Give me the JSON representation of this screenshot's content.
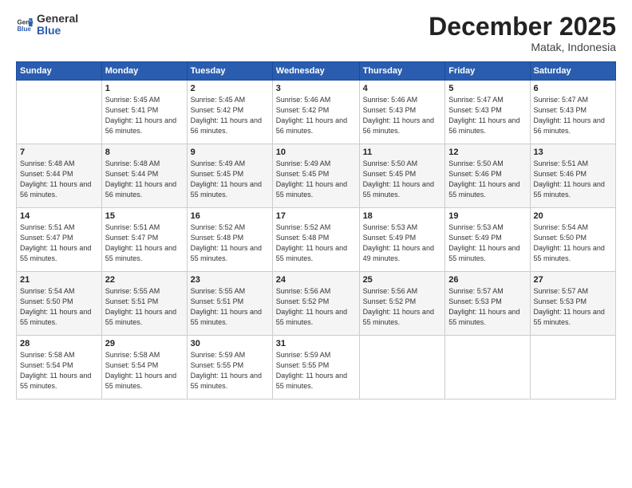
{
  "header": {
    "logo_general": "General",
    "logo_blue": "Blue",
    "month_title": "December 2025",
    "location": "Matak, Indonesia"
  },
  "days_of_week": [
    "Sunday",
    "Monday",
    "Tuesday",
    "Wednesday",
    "Thursday",
    "Friday",
    "Saturday"
  ],
  "weeks": [
    [
      {
        "day": "",
        "sunrise": "",
        "sunset": "",
        "daylight": ""
      },
      {
        "day": "1",
        "sunrise": "Sunrise: 5:45 AM",
        "sunset": "Sunset: 5:41 PM",
        "daylight": "Daylight: 11 hours and 56 minutes."
      },
      {
        "day": "2",
        "sunrise": "Sunrise: 5:45 AM",
        "sunset": "Sunset: 5:42 PM",
        "daylight": "Daylight: 11 hours and 56 minutes."
      },
      {
        "day": "3",
        "sunrise": "Sunrise: 5:46 AM",
        "sunset": "Sunset: 5:42 PM",
        "daylight": "Daylight: 11 hours and 56 minutes."
      },
      {
        "day": "4",
        "sunrise": "Sunrise: 5:46 AM",
        "sunset": "Sunset: 5:43 PM",
        "daylight": "Daylight: 11 hours and 56 minutes."
      },
      {
        "day": "5",
        "sunrise": "Sunrise: 5:47 AM",
        "sunset": "Sunset: 5:43 PM",
        "daylight": "Daylight: 11 hours and 56 minutes."
      },
      {
        "day": "6",
        "sunrise": "Sunrise: 5:47 AM",
        "sunset": "Sunset: 5:43 PM",
        "daylight": "Daylight: 11 hours and 56 minutes."
      }
    ],
    [
      {
        "day": "7",
        "sunrise": "Sunrise: 5:48 AM",
        "sunset": "Sunset: 5:44 PM",
        "daylight": "Daylight: 11 hours and 56 minutes."
      },
      {
        "day": "8",
        "sunrise": "Sunrise: 5:48 AM",
        "sunset": "Sunset: 5:44 PM",
        "daylight": "Daylight: 11 hours and 56 minutes."
      },
      {
        "day": "9",
        "sunrise": "Sunrise: 5:49 AM",
        "sunset": "Sunset: 5:45 PM",
        "daylight": "Daylight: 11 hours and 55 minutes."
      },
      {
        "day": "10",
        "sunrise": "Sunrise: 5:49 AM",
        "sunset": "Sunset: 5:45 PM",
        "daylight": "Daylight: 11 hours and 55 minutes."
      },
      {
        "day": "11",
        "sunrise": "Sunrise: 5:50 AM",
        "sunset": "Sunset: 5:45 PM",
        "daylight": "Daylight: 11 hours and 55 minutes."
      },
      {
        "day": "12",
        "sunrise": "Sunrise: 5:50 AM",
        "sunset": "Sunset: 5:46 PM",
        "daylight": "Daylight: 11 hours and 55 minutes."
      },
      {
        "day": "13",
        "sunrise": "Sunrise: 5:51 AM",
        "sunset": "Sunset: 5:46 PM",
        "daylight": "Daylight: 11 hours and 55 minutes."
      }
    ],
    [
      {
        "day": "14",
        "sunrise": "Sunrise: 5:51 AM",
        "sunset": "Sunset: 5:47 PM",
        "daylight": "Daylight: 11 hours and 55 minutes."
      },
      {
        "day": "15",
        "sunrise": "Sunrise: 5:51 AM",
        "sunset": "Sunset: 5:47 PM",
        "daylight": "Daylight: 11 hours and 55 minutes."
      },
      {
        "day": "16",
        "sunrise": "Sunrise: 5:52 AM",
        "sunset": "Sunset: 5:48 PM",
        "daylight": "Daylight: 11 hours and 55 minutes."
      },
      {
        "day": "17",
        "sunrise": "Sunrise: 5:52 AM",
        "sunset": "Sunset: 5:48 PM",
        "daylight": "Daylight: 11 hours and 55 minutes."
      },
      {
        "day": "18",
        "sunrise": "Sunrise: 5:53 AM",
        "sunset": "Sunset: 5:49 PM",
        "daylight": "Daylight: 11 hours and 49 minutes."
      },
      {
        "day": "19",
        "sunrise": "Sunrise: 5:53 AM",
        "sunset": "Sunset: 5:49 PM",
        "daylight": "Daylight: 11 hours and 55 minutes."
      },
      {
        "day": "20",
        "sunrise": "Sunrise: 5:54 AM",
        "sunset": "Sunset: 5:50 PM",
        "daylight": "Daylight: 11 hours and 55 minutes."
      }
    ],
    [
      {
        "day": "21",
        "sunrise": "Sunrise: 5:54 AM",
        "sunset": "Sunset: 5:50 PM",
        "daylight": "Daylight: 11 hours and 55 minutes."
      },
      {
        "day": "22",
        "sunrise": "Sunrise: 5:55 AM",
        "sunset": "Sunset: 5:51 PM",
        "daylight": "Daylight: 11 hours and 55 minutes."
      },
      {
        "day": "23",
        "sunrise": "Sunrise: 5:55 AM",
        "sunset": "Sunset: 5:51 PM",
        "daylight": "Daylight: 11 hours and 55 minutes."
      },
      {
        "day": "24",
        "sunrise": "Sunrise: 5:56 AM",
        "sunset": "Sunset: 5:52 PM",
        "daylight": "Daylight: 11 hours and 55 minutes."
      },
      {
        "day": "25",
        "sunrise": "Sunrise: 5:56 AM",
        "sunset": "Sunset: 5:52 PM",
        "daylight": "Daylight: 11 hours and 55 minutes."
      },
      {
        "day": "26",
        "sunrise": "Sunrise: 5:57 AM",
        "sunset": "Sunset: 5:53 PM",
        "daylight": "Daylight: 11 hours and 55 minutes."
      },
      {
        "day": "27",
        "sunrise": "Sunrise: 5:57 AM",
        "sunset": "Sunset: 5:53 PM",
        "daylight": "Daylight: 11 hours and 55 minutes."
      }
    ],
    [
      {
        "day": "28",
        "sunrise": "Sunrise: 5:58 AM",
        "sunset": "Sunset: 5:54 PM",
        "daylight": "Daylight: 11 hours and 55 minutes."
      },
      {
        "day": "29",
        "sunrise": "Sunrise: 5:58 AM",
        "sunset": "Sunset: 5:54 PM",
        "daylight": "Daylight: 11 hours and 55 minutes."
      },
      {
        "day": "30",
        "sunrise": "Sunrise: 5:59 AM",
        "sunset": "Sunset: 5:55 PM",
        "daylight": "Daylight: 11 hours and 55 minutes."
      },
      {
        "day": "31",
        "sunrise": "Sunrise: 5:59 AM",
        "sunset": "Sunset: 5:55 PM",
        "daylight": "Daylight: 11 hours and 55 minutes."
      },
      {
        "day": "",
        "sunrise": "",
        "sunset": "",
        "daylight": ""
      },
      {
        "day": "",
        "sunrise": "",
        "sunset": "",
        "daylight": ""
      },
      {
        "day": "",
        "sunrise": "",
        "sunset": "",
        "daylight": ""
      }
    ]
  ]
}
